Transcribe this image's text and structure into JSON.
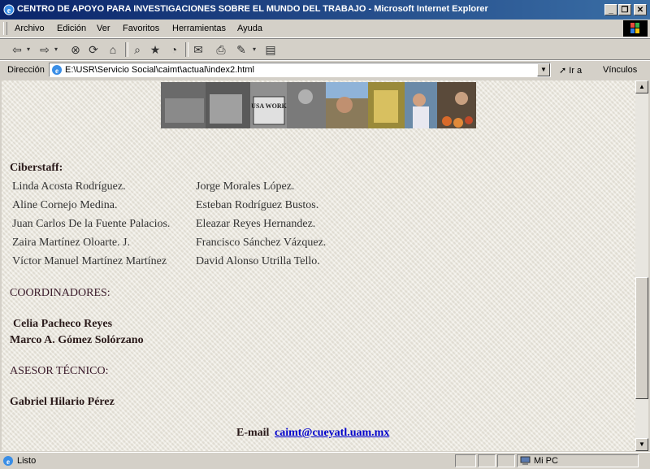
{
  "window": {
    "title": "CENTRO DE APOYO PARA INVESTIGACIONES SOBRE EL MUNDO DEL TRABAJO - Microsoft Internet Explorer",
    "minimize": "_",
    "restore": "❐",
    "close": "✕"
  },
  "menu": {
    "items": [
      "Archivo",
      "Edición",
      "Ver",
      "Favoritos",
      "Herramientas",
      "Ayuda"
    ]
  },
  "address": {
    "label": "Dirección",
    "url": "E:\\USR\\Servicio Social\\caimt\\actual\\index2.html",
    "go_label": "Ir a",
    "links_label": "Vínculos"
  },
  "content": {
    "banner_sign": "USA WORK PROGRAM WPA",
    "ciberstaff_heading": "Ciberstaff:",
    "staff_left": [
      "Linda Acosta Rodríguez.",
      "Aline Cornejo Medina.",
      "Juan Carlos De la Fuente Palacios.",
      "Zaira Martínez Oloarte. J.",
      "Víctor Manuel Martínez Martínez"
    ],
    "staff_right": [
      "Jorge Morales López.",
      "Esteban Rodríguez Bustos.",
      "Eleazar Reyes Hernandez.",
      "Francisco Sánchez Vázquez.",
      "David Alonso Utrilla Tello."
    ],
    "coordinadores_heading": "COORDINADORES:",
    "coordinadores": [
      "Celia Pacheco Reyes",
      "Marco A. Gómez Solórzano"
    ],
    "asesor_heading": "ASESOR TÉCNICO:",
    "asesor": "Gabriel Hilario Pérez",
    "email_label": "E-mail",
    "email": "caimt@cueyatl.uam.mx"
  },
  "status": {
    "text": "Listo",
    "zone": "Mi PC"
  },
  "colors": {
    "titlebar_start": "#0a246a",
    "titlebar_end": "#3a6ea5",
    "link": "#0000cc",
    "page_bg": "#ece8de"
  }
}
